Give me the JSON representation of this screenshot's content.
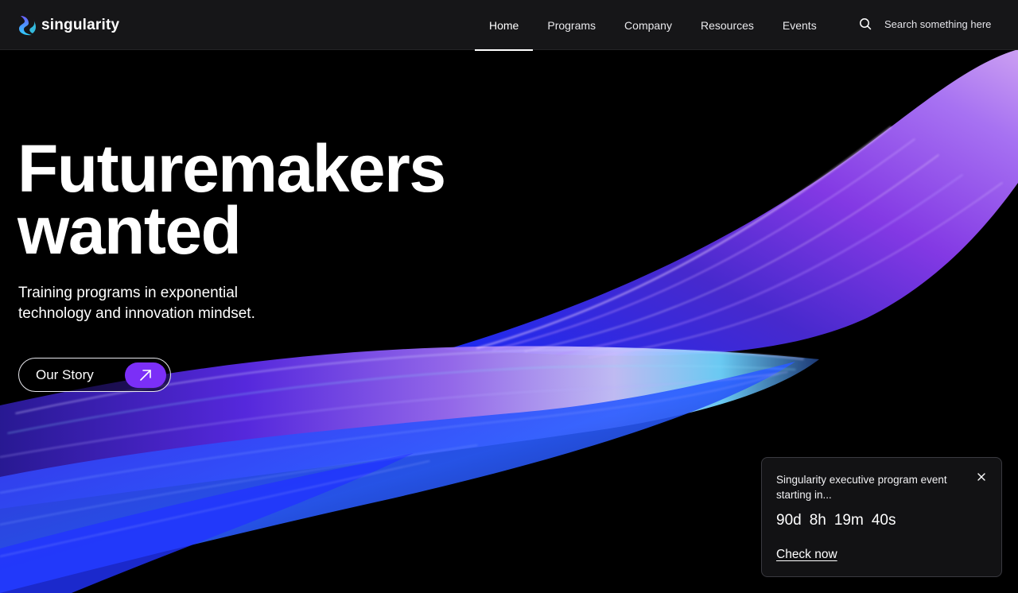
{
  "brand": {
    "name": "singularity",
    "colors": {
      "accent": "#7b2ff7",
      "logo_top": "#6a5cff",
      "logo_bottom": "#2fd0ff"
    }
  },
  "nav": {
    "items": [
      {
        "label": "Home",
        "active": true
      },
      {
        "label": "Programs",
        "active": false
      },
      {
        "label": "Company",
        "active": false
      },
      {
        "label": "Resources",
        "active": false
      },
      {
        "label": "Events",
        "active": false
      }
    ],
    "search": {
      "icon": "search-icon",
      "placeholder": "Search something here"
    }
  },
  "hero": {
    "title_line1": "Futuremakers",
    "title_line2": "wanted",
    "subtitle": "Training programs in exponential technology and innovation mindset.",
    "cta": {
      "label": "Our Story",
      "icon": "arrow-up-right-icon"
    }
  },
  "event_popup": {
    "text": "Singularity executive program event starting in...",
    "countdown": {
      "days": "90d",
      "hours": "8h",
      "minutes": "19m",
      "seconds": "40s"
    },
    "link_label": "Check now",
    "close_icon": "close-icon"
  }
}
